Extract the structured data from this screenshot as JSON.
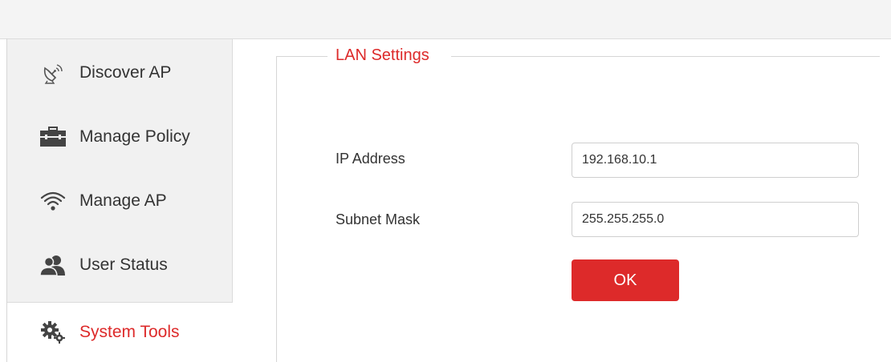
{
  "sidebar": {
    "items": [
      {
        "label": "Discover AP",
        "icon": "satellite-dish-icon"
      },
      {
        "label": "Manage Policy",
        "icon": "briefcase-icon"
      },
      {
        "label": "Manage AP",
        "icon": "wifi-icon"
      },
      {
        "label": "User Status",
        "icon": "users-icon"
      },
      {
        "label": "System Tools",
        "icon": "gears-icon",
        "active": true
      }
    ]
  },
  "main": {
    "section_title": "LAN Settings",
    "ip_address": {
      "label": "IP Address",
      "value": "192.168.10.1"
    },
    "subnet_mask": {
      "label": "Subnet Mask",
      "value": "255.255.255.0"
    },
    "ok_label": "OK"
  },
  "colors": {
    "accent": "#dd2a2a",
    "sidebar_bg": "#f1f1f1",
    "text": "#333333"
  }
}
